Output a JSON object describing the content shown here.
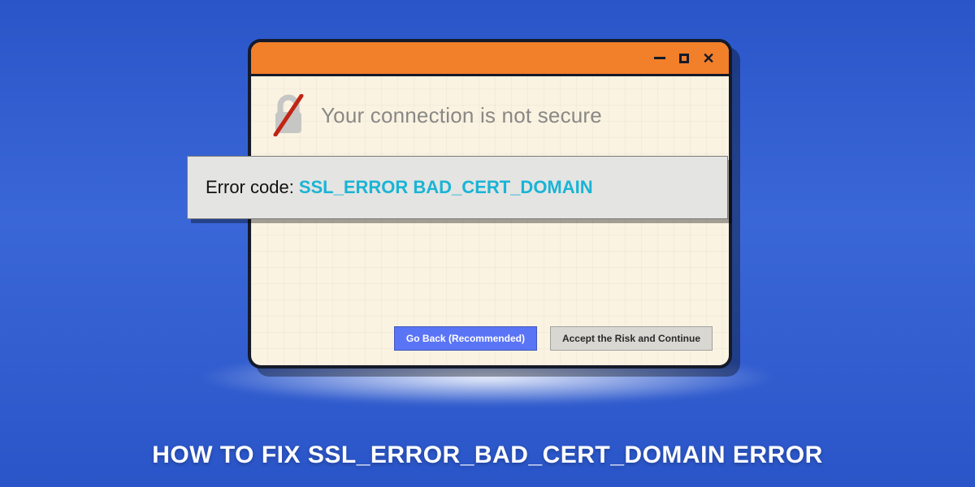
{
  "window": {
    "controls": {
      "minimize": "minimize",
      "maximize": "maximize",
      "close": "close"
    }
  },
  "page": {
    "heading": "Your connection is not secure",
    "lock_icon": "lock-insecure-icon"
  },
  "error": {
    "label": "Error code:",
    "code": "SSL_ERROR BAD_CERT_DOMAIN"
  },
  "actions": {
    "go_back": "Go Back (Recommended)",
    "accept": "Accept the Risk and Continue"
  },
  "footer": {
    "title": "HOW TO FIX SSL_ERROR_BAD_CERT_DOMAIN ERROR"
  },
  "colors": {
    "accent_orange": "#f27f2a",
    "error_code": "#19b4d6",
    "primary_button": "#5a74f6"
  }
}
